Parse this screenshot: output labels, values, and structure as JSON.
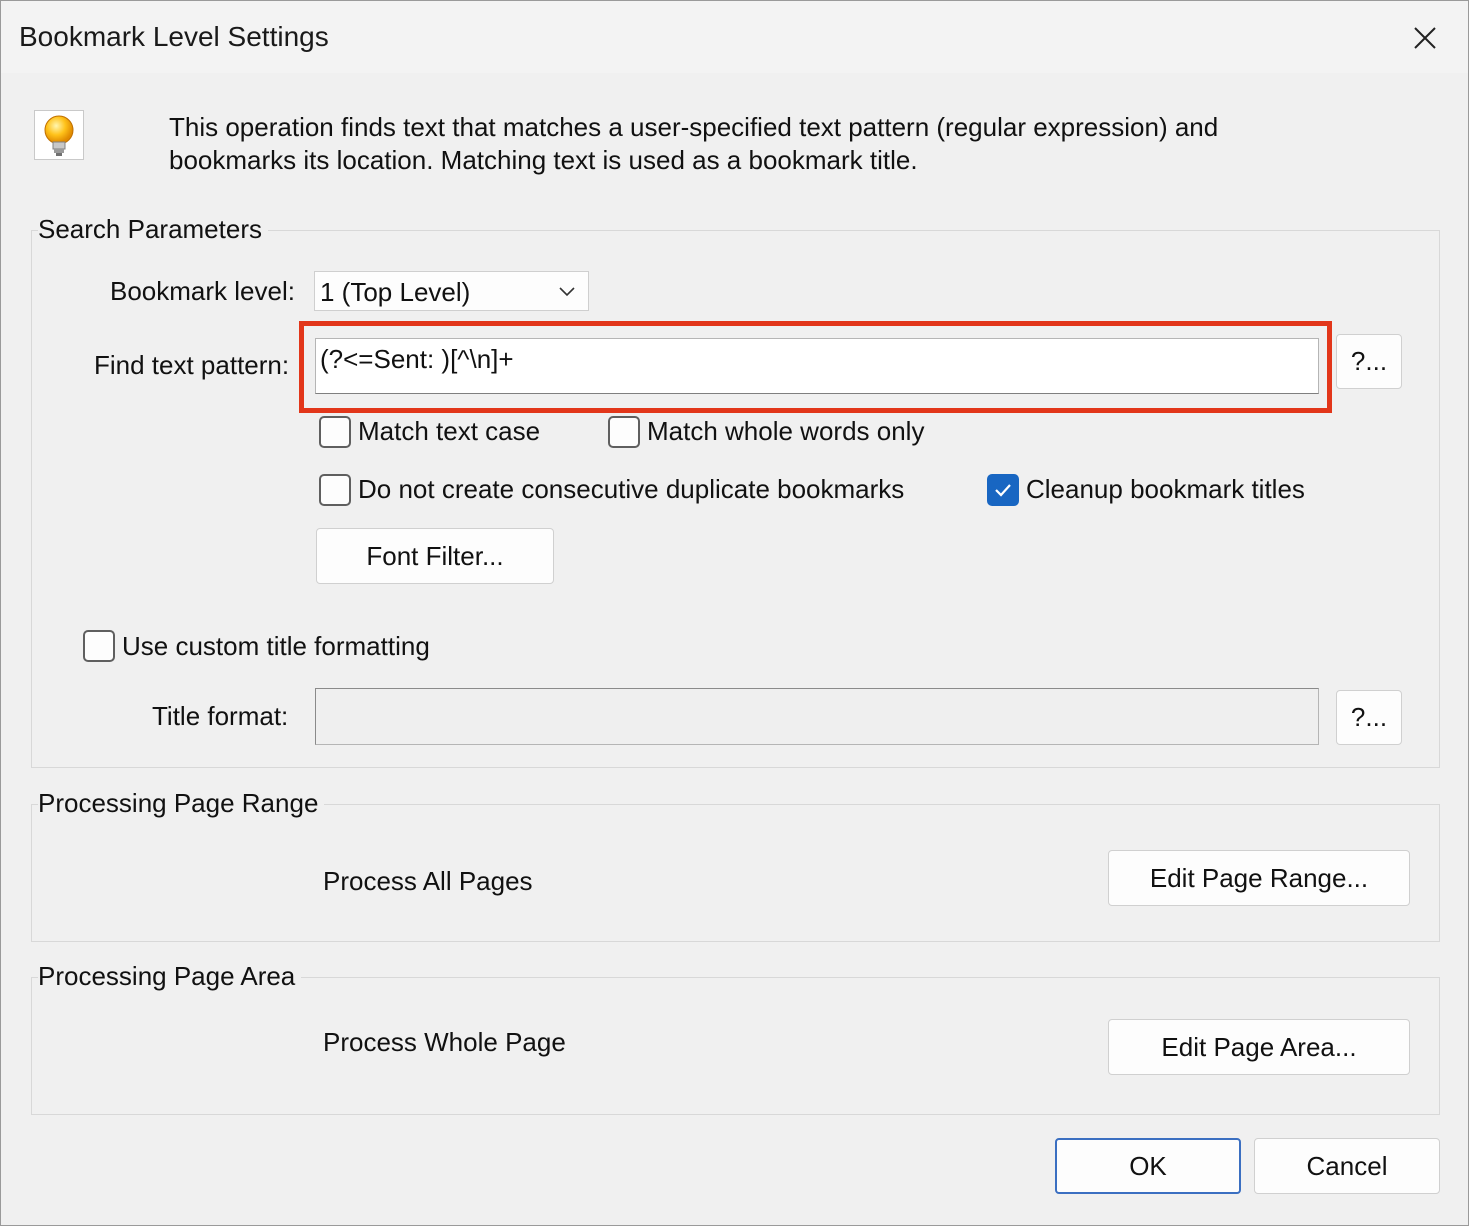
{
  "window": {
    "title": "Bookmark Level Settings"
  },
  "description": {
    "line1": "This operation finds text that matches a user-specified text pattern (regular expression) and",
    "line2": "bookmarks its location. Matching text is used as a bookmark title."
  },
  "search_parameters": {
    "group_title": "Search Parameters",
    "bookmark_level_label": "Bookmark level:",
    "bookmark_level_value": "1 (Top Level)",
    "find_text_pattern_label": "Find text pattern:",
    "find_text_pattern_value": "(?<=Sent: )[^\\n]+",
    "help_button_label": "?...",
    "match_text_case": {
      "label": "Match text case",
      "checked": false
    },
    "match_whole_words": {
      "label": "Match whole words only",
      "checked": false
    },
    "no_consecutive_duplicates": {
      "label": "Do not create consecutive duplicate bookmarks",
      "checked": false
    },
    "cleanup_titles": {
      "label": "Cleanup bookmark titles",
      "checked": true
    },
    "font_filter_button": "Font Filter...",
    "use_custom_title": {
      "label": "Use custom title formatting",
      "checked": false
    },
    "title_format_label": "Title format:",
    "title_format_value": "",
    "title_help_button_label": "?..."
  },
  "page_range": {
    "group_title": "Processing Page Range",
    "status": "Process All Pages",
    "edit_button": "Edit Page Range..."
  },
  "page_area": {
    "group_title": "Processing Page Area",
    "status": "Process Whole Page",
    "edit_button": "Edit Page Area..."
  },
  "footer": {
    "ok_label": "OK",
    "cancel_label": "Cancel"
  },
  "colors": {
    "highlight_border": "#e2361a",
    "checkbox_checked": "#1866c2",
    "default_button_border": "#3b6fc1"
  }
}
